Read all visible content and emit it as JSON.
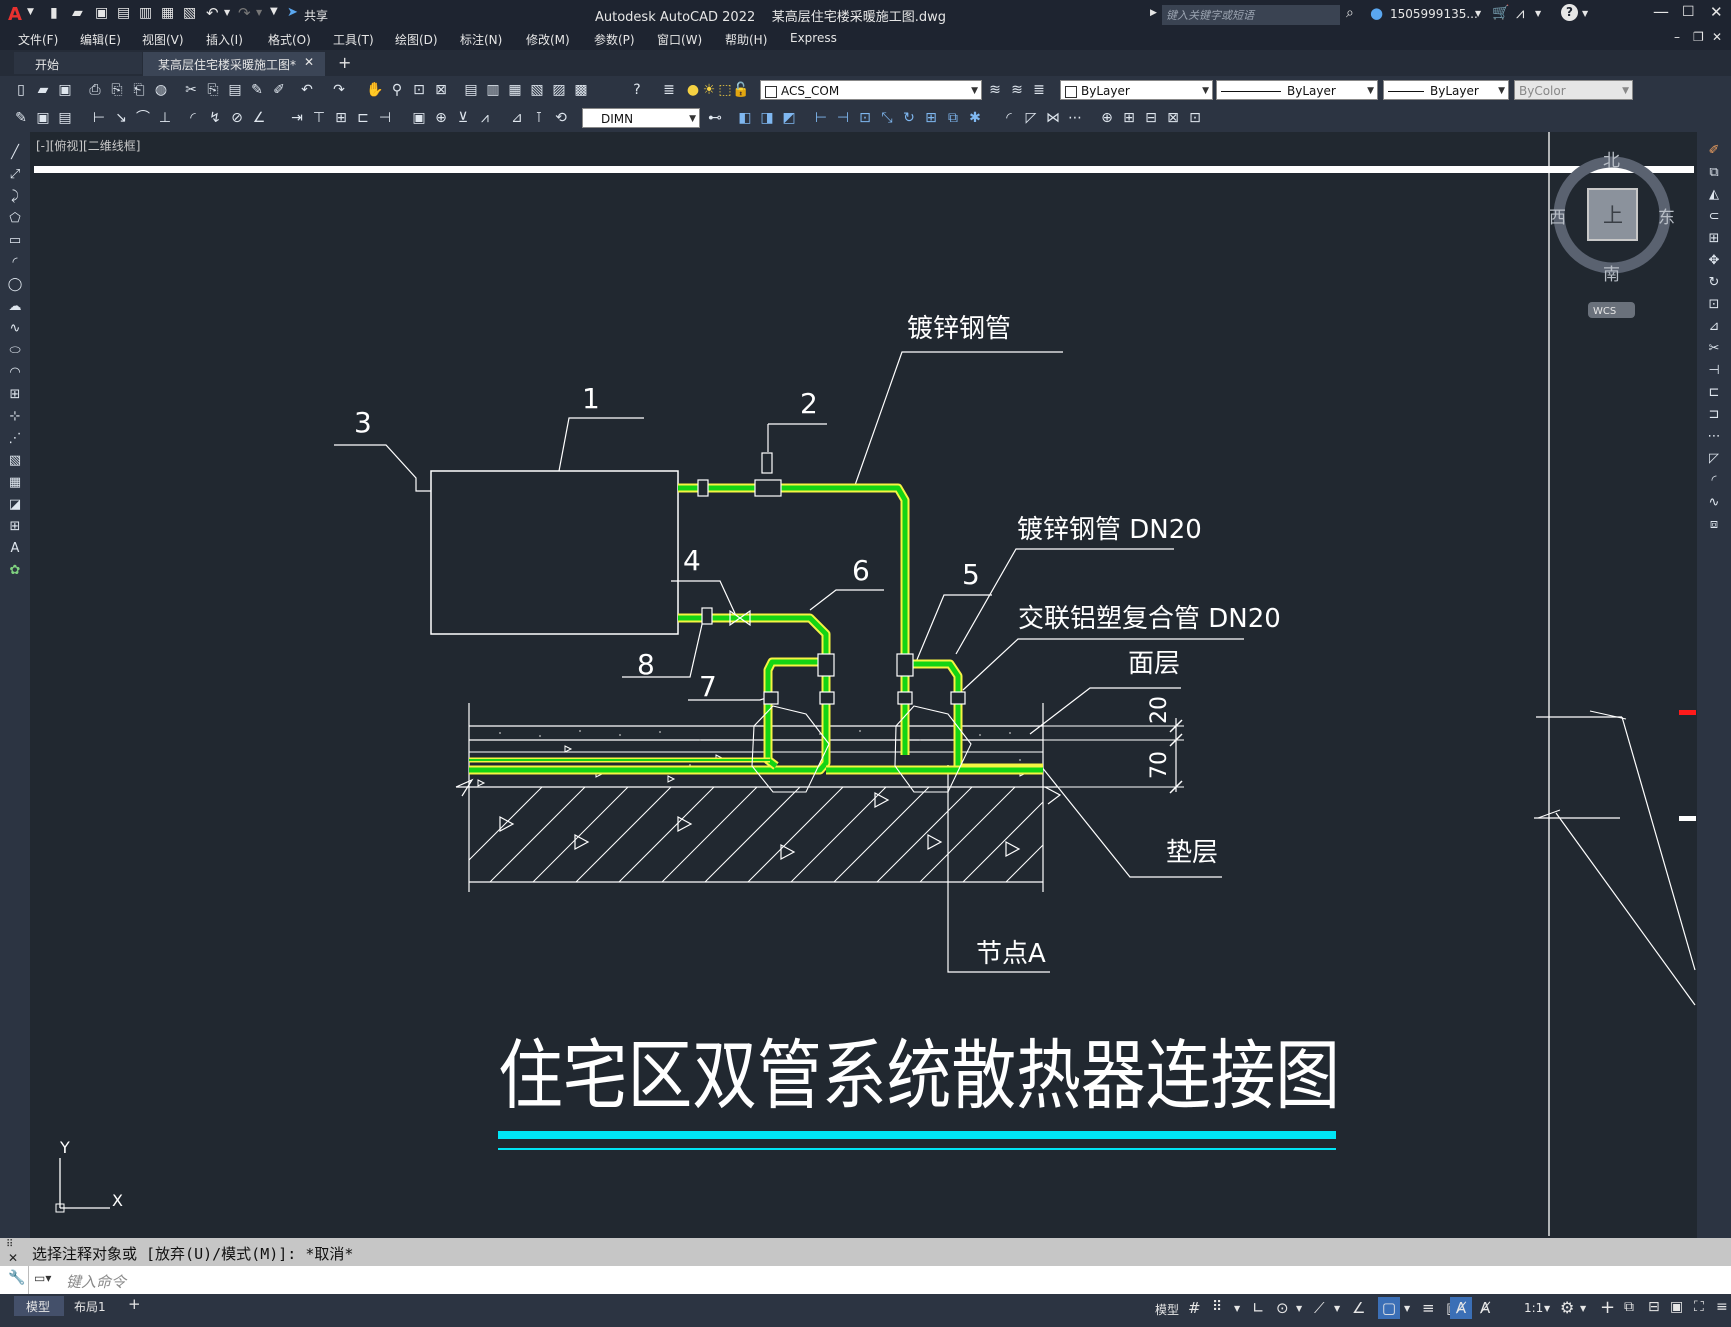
{
  "titlebar": {
    "app_logo": "A",
    "share_label": "共享",
    "window_title": "Autodesk AutoCAD 2022    某高层住宅楼采暖施工图.dwg",
    "search_placeholder": "键入关键字或短语",
    "user_name": "1505999135...",
    "help_icon": "?"
  },
  "menubar": {
    "items": [
      "文件(F)",
      "编辑(E)",
      "视图(V)",
      "插入(I)",
      "格式(O)",
      "工具(T)",
      "绘图(D)",
      "标注(N)",
      "修改(M)",
      "参数(P)",
      "窗口(W)",
      "帮助(H)",
      "Express"
    ]
  },
  "tabs": {
    "start": "开始",
    "active": "某高层住宅楼采暖施工图*",
    "add": "+"
  },
  "toolbar1": {
    "layer_name": "ACS_COM",
    "color": "ByLayer",
    "linetype": "ByLayer",
    "lineweight": "ByLayer",
    "plotstyle": "ByColor"
  },
  "toolbar2": {
    "dimstyle": "DIMN"
  },
  "viewport": {
    "label": "[-][俯视][二维线框]"
  },
  "viewcube": {
    "north": "北",
    "south": "南",
    "east": "东",
    "west": "西",
    "face": "上",
    "wcs": "WCS"
  },
  "drawing": {
    "callout_1": "1",
    "callout_2": "2",
    "callout_3": "3",
    "callout_4": "4",
    "callout_5": "5",
    "callout_6": "6",
    "callout_7": "7",
    "callout_8": "8",
    "label_galv_pipe": "镀锌钢管",
    "label_galv_pipe_dn20": "镀锌钢管 DN20",
    "label_pex_al": "交联铝塑复合管 DN20",
    "label_surface": "面层",
    "label_cushion": "垫层",
    "label_node": "节点A",
    "dim_20": "20",
    "dim_70": "70",
    "title": "住宅区双管系统散热器连接图",
    "ucs_x": "X",
    "ucs_y": "Y"
  },
  "command": {
    "history": "选择注释对象或 [放弃(U)/模式(M)]: *取消*",
    "placeholder": "键入命令"
  },
  "status": {
    "model_tab": "模型",
    "layout_tab": "布局1",
    "add_tab": "+",
    "model_label": "模型",
    "scale": "1:1"
  },
  "colors": {
    "background": "#212830",
    "pipe_green": "#14d414",
    "pipe_yellow": "#f5f542",
    "title_cyan": "#00e5f5",
    "toolbar": "#2c3442"
  }
}
